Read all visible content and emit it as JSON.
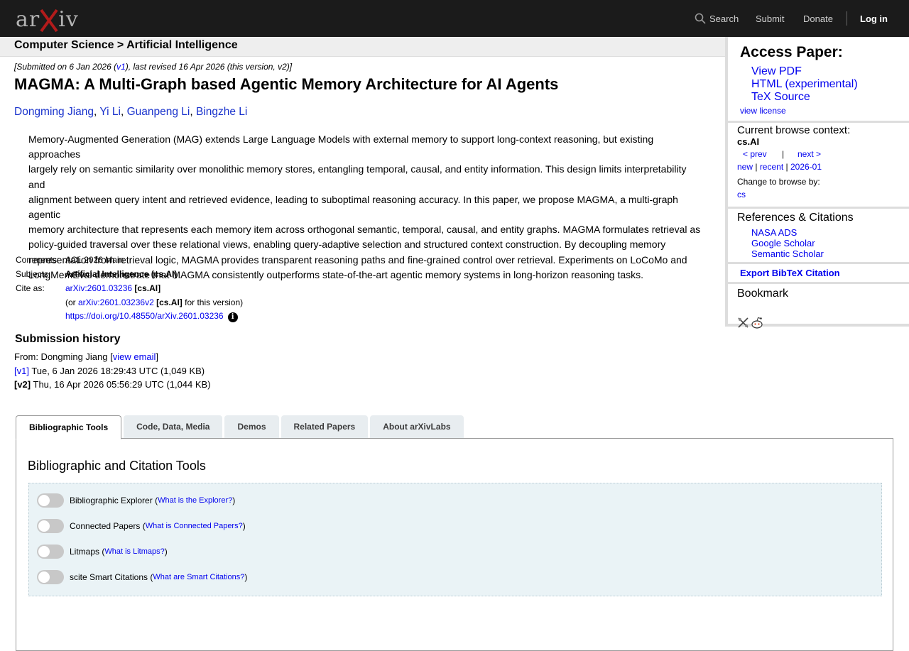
{
  "header": {
    "logo_text": "arXiv",
    "logo_prefix": "ar",
    "logo_suffix": "iv",
    "nav": {
      "search": "Search",
      "submit": "Submit",
      "donate": "Donate",
      "login": "Log in"
    }
  },
  "breadcrumb": "Computer Science > Artificial Intelligence",
  "paper": {
    "dateline": {
      "prefix": "[Submitted on 6 Jan 2026 (",
      "v1": "v1",
      "suffix": "), last revised 16 Apr 2026 (this version, v2)]"
    },
    "title": "MAGMA: A Multi-Graph based Agentic Memory Architecture for AI Agents",
    "authors": [
      "Dongming Jiang",
      "Yi Li",
      "Guanpeng Li",
      "Bingzhe Li"
    ],
    "abstract_lines": [
      "Memory-Augmented Generation (MAG) extends Large Language Models with external memory to support long-context reasoning, but existing approaches",
      "largely rely on semantic similarity over monolithic memory stores, entangling temporal, causal, and entity information. This design limits interpretability and",
      "alignment between query intent and retrieved evidence, leading to suboptimal reasoning accuracy. In this paper, we propose MAGMA, a multi-graph agentic",
      "memory architecture that represents each memory item across orthogonal semantic, temporal, causal, and entity graphs. MAGMA formulates retrieval as",
      "policy-guided traversal over these relational views, enabling query-adaptive selection and structured context construction. By decoupling memory",
      "representation from retrieval logic, MAGMA provides transparent reasoning paths and fine-grained control over retrieval. Experiments on LoCoMo and",
      "LongMemEval demonstrate that MAGMA consistently outperforms state-of-the-art agentic memory systems in long-horizon reasoning tasks."
    ],
    "meta": {
      "comments_label": "Comments:",
      "comments": "ACL 2026 Main",
      "subjects_label": "Subjects:",
      "subjects": "Artificial Intelligence (cs.AI)",
      "cite_label": "Cite as:",
      "cite_id": "arXiv:2601.03236",
      "cite_cat": "[cs.AI]",
      "cite2_prefix": "(or ",
      "cite2_id": "arXiv:2601.03236v2",
      "cite2_cat": "[cs.AI]",
      "cite2_suffix": " for this version)",
      "doi": "https://doi.org/10.48550/arXiv.2601.03236",
      "info_icon": "info-circle-icon"
    },
    "history": {
      "heading": "Submission history",
      "from_prefix": "From: Dongming Jiang [",
      "view_email": "view email",
      "from_suffix": "]",
      "v1_label": "[v1]",
      "v1_text": " Tue, 6 Jan 2026 18:29:43 UTC (1,049 KB)",
      "v2_label": "[v2]",
      "v2_text": " Thu, 16 Apr 2026 05:56:29 UTC (1,044 KB)"
    }
  },
  "tabs": [
    "Bibliographic Tools",
    "Code, Data, Media",
    "Demos",
    "Related Papers",
    "About arXivLabs"
  ],
  "tools": {
    "heading": "Bibliographic and Citation Tools",
    "items": [
      {
        "label": "Bibliographic Explorer",
        "help": "What is the Explorer?"
      },
      {
        "label": "Connected Papers",
        "help": "What is Connected Papers?"
      },
      {
        "label": "Litmaps",
        "help": "What is Litmaps?"
      },
      {
        "label": "scite Smart Citations",
        "help": "What are Smart Citations?"
      }
    ]
  },
  "sidebar": {
    "access_title": "Access Paper:",
    "downloads": [
      "View PDF",
      "HTML (experimental)",
      "TeX Source"
    ],
    "view_license": "view license",
    "context_label": "Current browse context:",
    "context_value": "cs.AI",
    "prev": "< prev",
    "pipe": "|",
    "next": "next >",
    "new": "new",
    "recent": "recent",
    "month": "2026-01",
    "change_label": "Change to browse by:",
    "change_value": "cs",
    "refs_title": "References & Citations",
    "refs": [
      "NASA ADS",
      "Google Scholar",
      "Semantic Scholar"
    ],
    "export": "Export BibTeX Citation",
    "bookmark_title": "Bookmark"
  },
  "colors": {
    "topbar": "#1b1b1b",
    "link": "#0000ee",
    "logo_x": "#b31b1b",
    "toolbox_bg": "#eaf3f6"
  }
}
